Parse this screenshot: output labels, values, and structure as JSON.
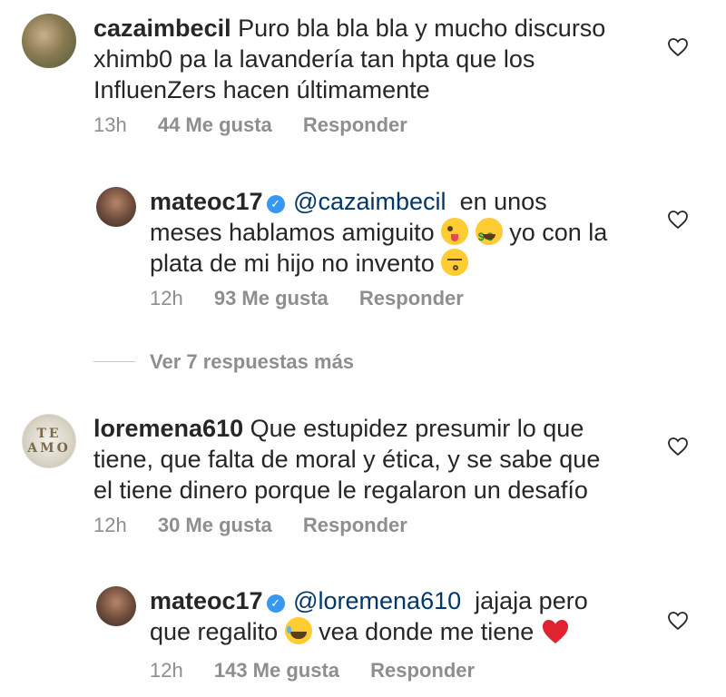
{
  "comments": [
    {
      "username": "cazaimbecil",
      "text_lines": [
        "Puro bla bla bla y mucho discurso",
        "xhimb0 pa la lavandería tan hpta que los",
        "InfluenZers hacen últimamente"
      ],
      "time": "13h",
      "likes": "44 Me gusta",
      "reply": "Responder"
    },
    {
      "username": "mateoc17",
      "mention": "@cazaimbecil",
      "text_line1_rest": "en unos",
      "text_line2_a": "meses hablamos amiguito",
      "text_line2_b": "yo con la",
      "text_line3": "plata de mi hijo no invento",
      "time": "12h",
      "likes": "93 Me gusta",
      "reply": "Responder"
    },
    {
      "username": "loremena610",
      "text_lines": [
        "Que estupidez presumir lo que",
        "tiene, que falta de moral y ética, y se sabe que",
        "el tiene dinero porque le regalaron un desafío"
      ],
      "time": "12h",
      "likes": "30 Me gusta",
      "reply": "Responder"
    },
    {
      "username": "mateoc17",
      "mention": "@loremena610",
      "text_line1_rest": "jajaja pero",
      "text_line2_a": "que regalito",
      "text_line2_b": "vea donde me tiene",
      "time": "12h",
      "likes": "143 Me gusta",
      "reply": "Responder"
    }
  ],
  "view_more": "Ver 7 respuestas más",
  "avatar_text": "TE AMO",
  "icons": {
    "like": "heart-outline-icon",
    "verified": "verified-badge-icon",
    "emoji_wink": "winking-tongue-emoji",
    "emoji_money": "money-mouth-emoji",
    "emoji_kiss": "kissing-closed-eyes-emoji",
    "emoji_laugh": "tears-of-joy-emoji",
    "emoji_heart": "red-heart-emoji"
  },
  "colors": {
    "text": "#262626",
    "meta": "#8e8e8e",
    "mention": "#00376b",
    "verified": "#3897f0"
  }
}
